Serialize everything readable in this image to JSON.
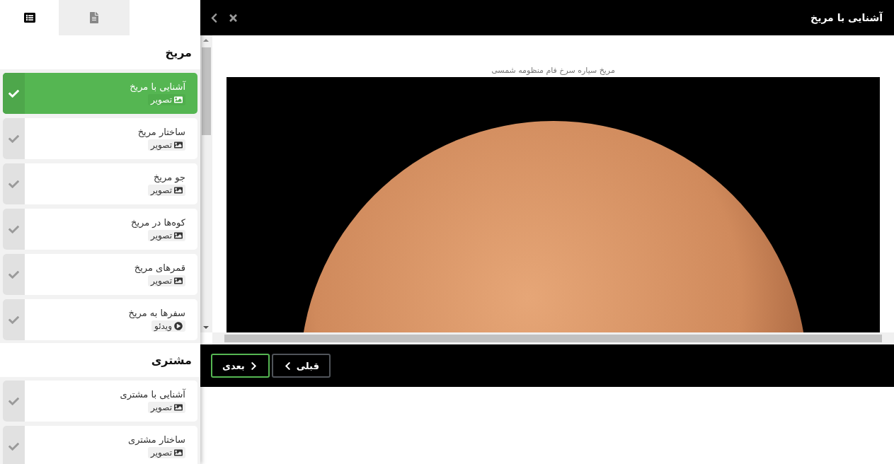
{
  "sidebar": {
    "tabs": [
      {
        "kind": "list",
        "selected": true
      },
      {
        "kind": "document",
        "selected": false
      }
    ],
    "sections": [
      {
        "title": "مریخ",
        "items": [
          {
            "title": "آشنایی با مریخ",
            "kind": "image",
            "type_label": "تصویر",
            "selected": true
          },
          {
            "title": "ساختار مریخ",
            "kind": "image",
            "type_label": "تصویر",
            "selected": false
          },
          {
            "title": "جو مریخ",
            "kind": "image",
            "type_label": "تصویر",
            "selected": false
          },
          {
            "title": "کوه‌ها در مریخ",
            "kind": "image",
            "type_label": "تصویر",
            "selected": false
          },
          {
            "title": "قمرهای مریخ",
            "kind": "image",
            "type_label": "تصویر",
            "selected": false
          },
          {
            "title": "سفرها به مریخ",
            "kind": "video",
            "type_label": "ویدئو",
            "selected": false
          }
        ]
      },
      {
        "title": "مشتری",
        "items": [
          {
            "title": "آشنایی با مشتری",
            "kind": "image",
            "type_label": "تصویر",
            "selected": false
          },
          {
            "title": "ساختار مشتری",
            "kind": "image",
            "type_label": "تصویر",
            "selected": false
          }
        ]
      }
    ]
  },
  "header": {
    "title": "آشنایی با مریخ"
  },
  "content": {
    "caption": "مریخ سیاره سرخ فام منظومه شمسی"
  },
  "footer": {
    "buttons": [
      {
        "label": "قبلی",
        "kind": "previous",
        "selected": false
      },
      {
        "label": "بعدی",
        "kind": "next",
        "selected": true
      }
    ]
  }
}
